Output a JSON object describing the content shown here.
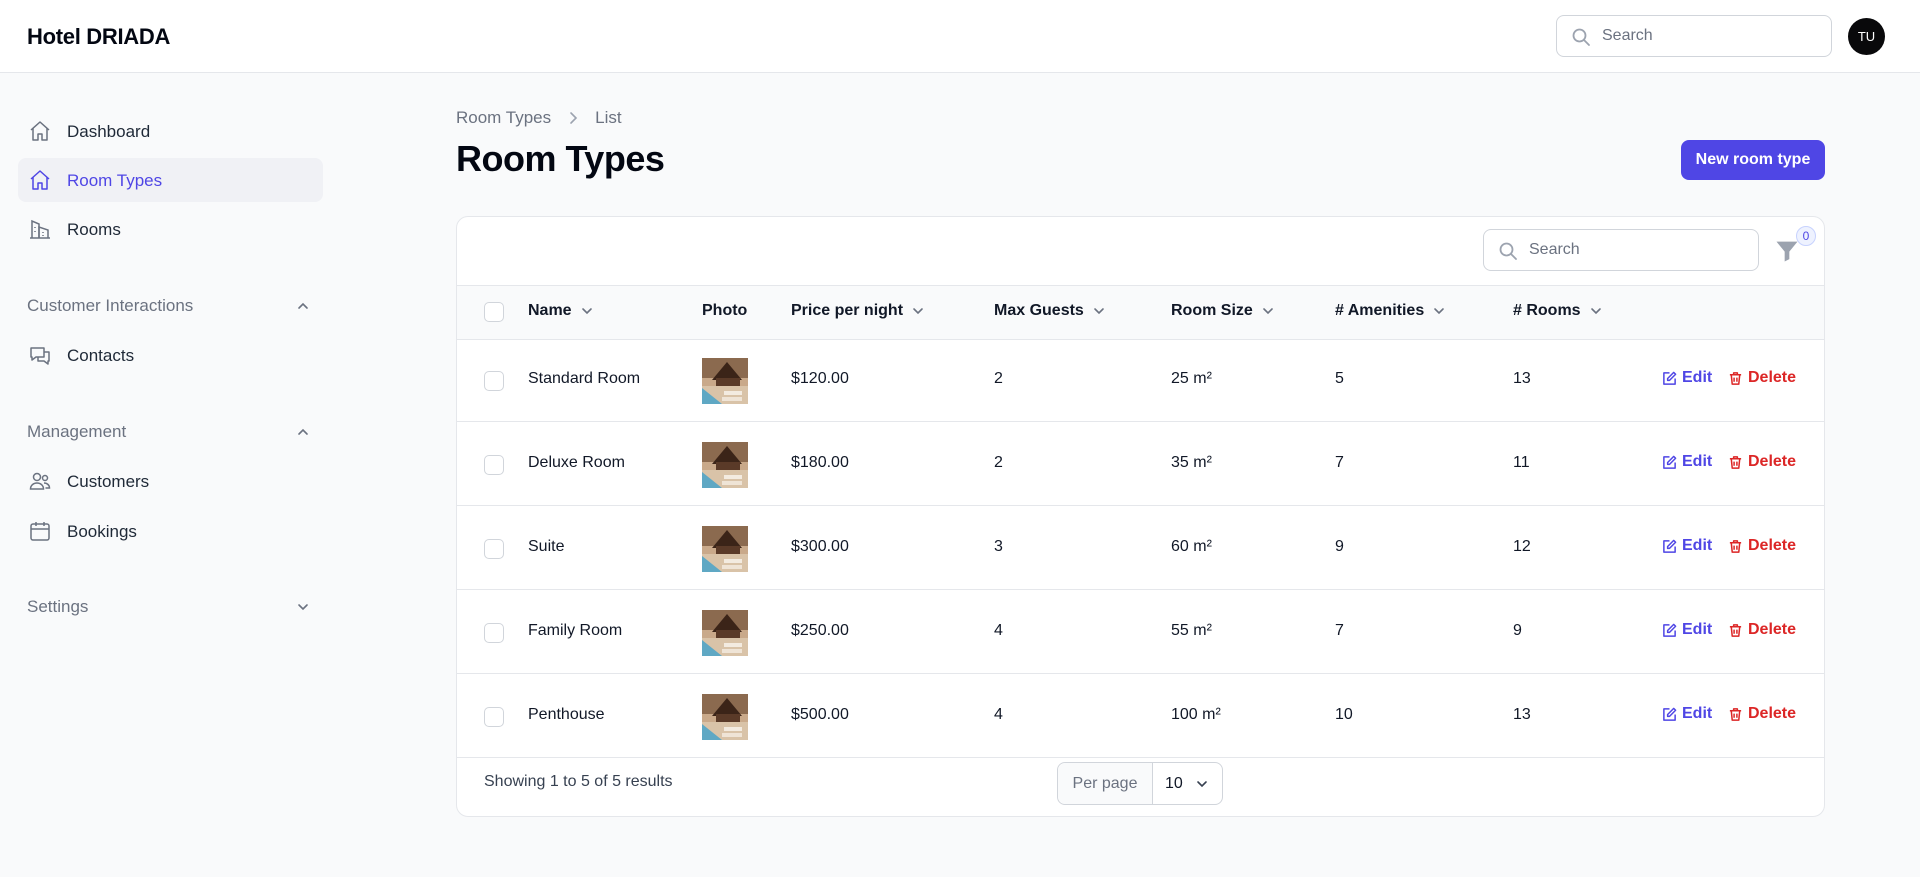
{
  "app": {
    "title": "Hotel DRIADA"
  },
  "header": {
    "search_placeholder": "Search",
    "avatar_initials": "TU"
  },
  "sidebar": {
    "items": [
      {
        "label": "Dashboard",
        "icon": "home-icon"
      },
      {
        "label": "Room Types",
        "icon": "home-icon",
        "active": true
      },
      {
        "label": "Rooms",
        "icon": "building-icon"
      }
    ],
    "groups": [
      {
        "label": "Customer Interactions",
        "expanded": true,
        "items": [
          {
            "label": "Contacts",
            "icon": "chat-icon"
          }
        ]
      },
      {
        "label": "Management",
        "expanded": true,
        "items": [
          {
            "label": "Customers",
            "icon": "users-icon"
          },
          {
            "label": "Bookings",
            "icon": "calendar-icon"
          }
        ]
      },
      {
        "label": "Settings",
        "expanded": false,
        "items": []
      }
    ]
  },
  "breadcrumb": {
    "parent": "Room Types",
    "current": "List"
  },
  "page": {
    "title": "Room Types",
    "new_button": "New room type"
  },
  "table": {
    "search_placeholder": "Search",
    "filter_count": "0",
    "columns": [
      "Name",
      "Photo",
      "Price per night",
      "Max Guests",
      "Room Size",
      "# Amenities",
      "# Rooms"
    ],
    "rows": [
      {
        "name": "Standard Room",
        "price": "$120.00",
        "guests": "2",
        "size": "25 m²",
        "amenities": "5",
        "rooms": "13"
      },
      {
        "name": "Deluxe Room",
        "price": "$180.00",
        "guests": "2",
        "size": "35 m²",
        "amenities": "7",
        "rooms": "11"
      },
      {
        "name": "Suite",
        "price": "$300.00",
        "guests": "3",
        "size": "60 m²",
        "amenities": "9",
        "rooms": "12"
      },
      {
        "name": "Family Room",
        "price": "$250.00",
        "guests": "4",
        "size": "55 m²",
        "amenities": "7",
        "rooms": "9"
      },
      {
        "name": "Penthouse",
        "price": "$500.00",
        "guests": "4",
        "size": "100 m²",
        "amenities": "10",
        "rooms": "13"
      }
    ],
    "edit_label": "Edit",
    "delete_label": "Delete",
    "footer": {
      "summary": "Showing 1 to 5 of 5 results",
      "per_page_label": "Per page",
      "per_page_value": "10"
    }
  },
  "colors": {
    "accent": "#4f46e5",
    "danger": "#dc2626",
    "text": "#111827",
    "muted": "#6b7280"
  }
}
